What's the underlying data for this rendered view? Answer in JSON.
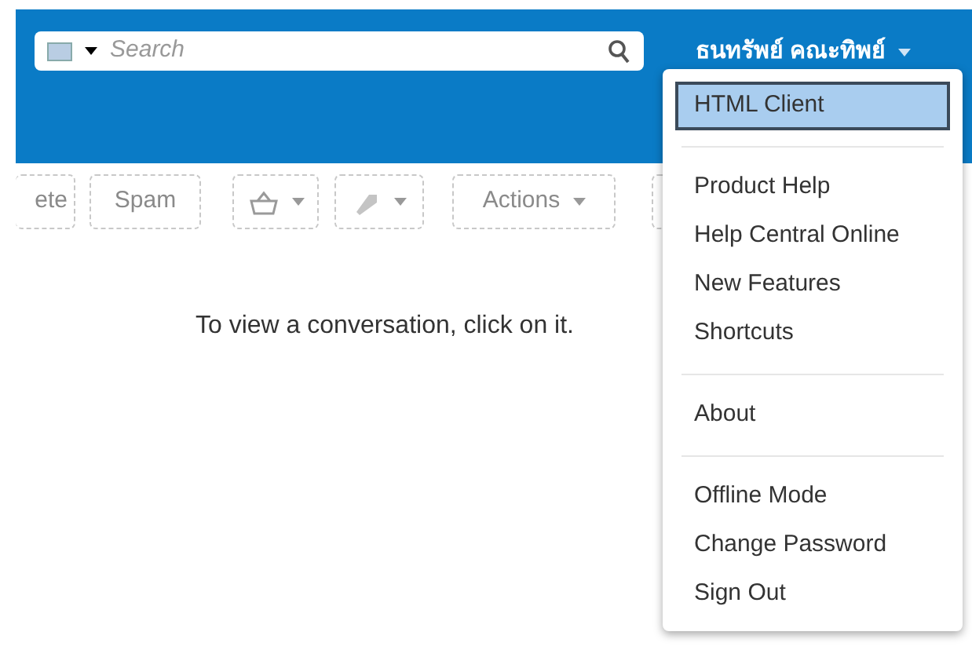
{
  "header": {
    "search": {
      "placeholder": "Search"
    },
    "user_name": "ธนทรัพย์ คณะทิพย์"
  },
  "toolbar": {
    "buttons": [
      {
        "kind": "text",
        "label": "ete"
      },
      {
        "kind": "text",
        "label": "Spam"
      },
      {
        "kind": "basket"
      },
      {
        "kind": "tag"
      },
      {
        "kind": "menu",
        "label": "Actions"
      },
      {
        "kind": "blank"
      }
    ]
  },
  "message": "To view a conversation, click on it.",
  "user_menu": {
    "sections": [
      [
        {
          "label": "HTML Client",
          "selected": true
        }
      ],
      [
        {
          "label": "Product Help",
          "selected": false
        },
        {
          "label": "Help Central Online",
          "selected": false
        },
        {
          "label": "New Features",
          "selected": false
        },
        {
          "label": "Shortcuts",
          "selected": false
        }
      ],
      [
        {
          "label": "About",
          "selected": false
        }
      ],
      [
        {
          "label": "Offline Mode",
          "selected": false
        },
        {
          "label": "Change Password",
          "selected": false
        },
        {
          "label": "Sign Out",
          "selected": false
        }
      ]
    ]
  }
}
